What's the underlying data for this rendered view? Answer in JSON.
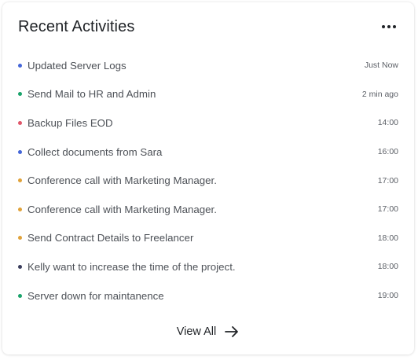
{
  "card": {
    "title": "Recent Activities"
  },
  "activities": [
    {
      "label": "Updated Server Logs",
      "time": "Just Now",
      "color": "#4466d8"
    },
    {
      "label": "Send Mail to HR and Admin",
      "time": "2 min ago",
      "color": "#1aa36b"
    },
    {
      "label": "Backup Files EOD",
      "time": "14:00",
      "color": "#e0566a"
    },
    {
      "label": "Collect documents from Sara",
      "time": "16:00",
      "color": "#4466d8"
    },
    {
      "label": "Conference call with Marketing Manager.",
      "time": "17:00",
      "color": "#e0a23a"
    },
    {
      "label": "Conference call with Marketing Manager.",
      "time": "17:00",
      "color": "#e0a23a"
    },
    {
      "label": "Send Contract Details to Freelancer",
      "time": "18:00",
      "color": "#e0a23a"
    },
    {
      "label": "Kelly want to increase the time of the project.",
      "time": "18:00",
      "color": "#3a3d5c"
    },
    {
      "label": "Server down for maintanence",
      "time": "19:00",
      "color": "#1aa36b"
    }
  ],
  "footer": {
    "view_all_label": "View All"
  },
  "icons": {
    "menu": "more-horizontal-icon",
    "view_all": "arrow-right-icon"
  }
}
